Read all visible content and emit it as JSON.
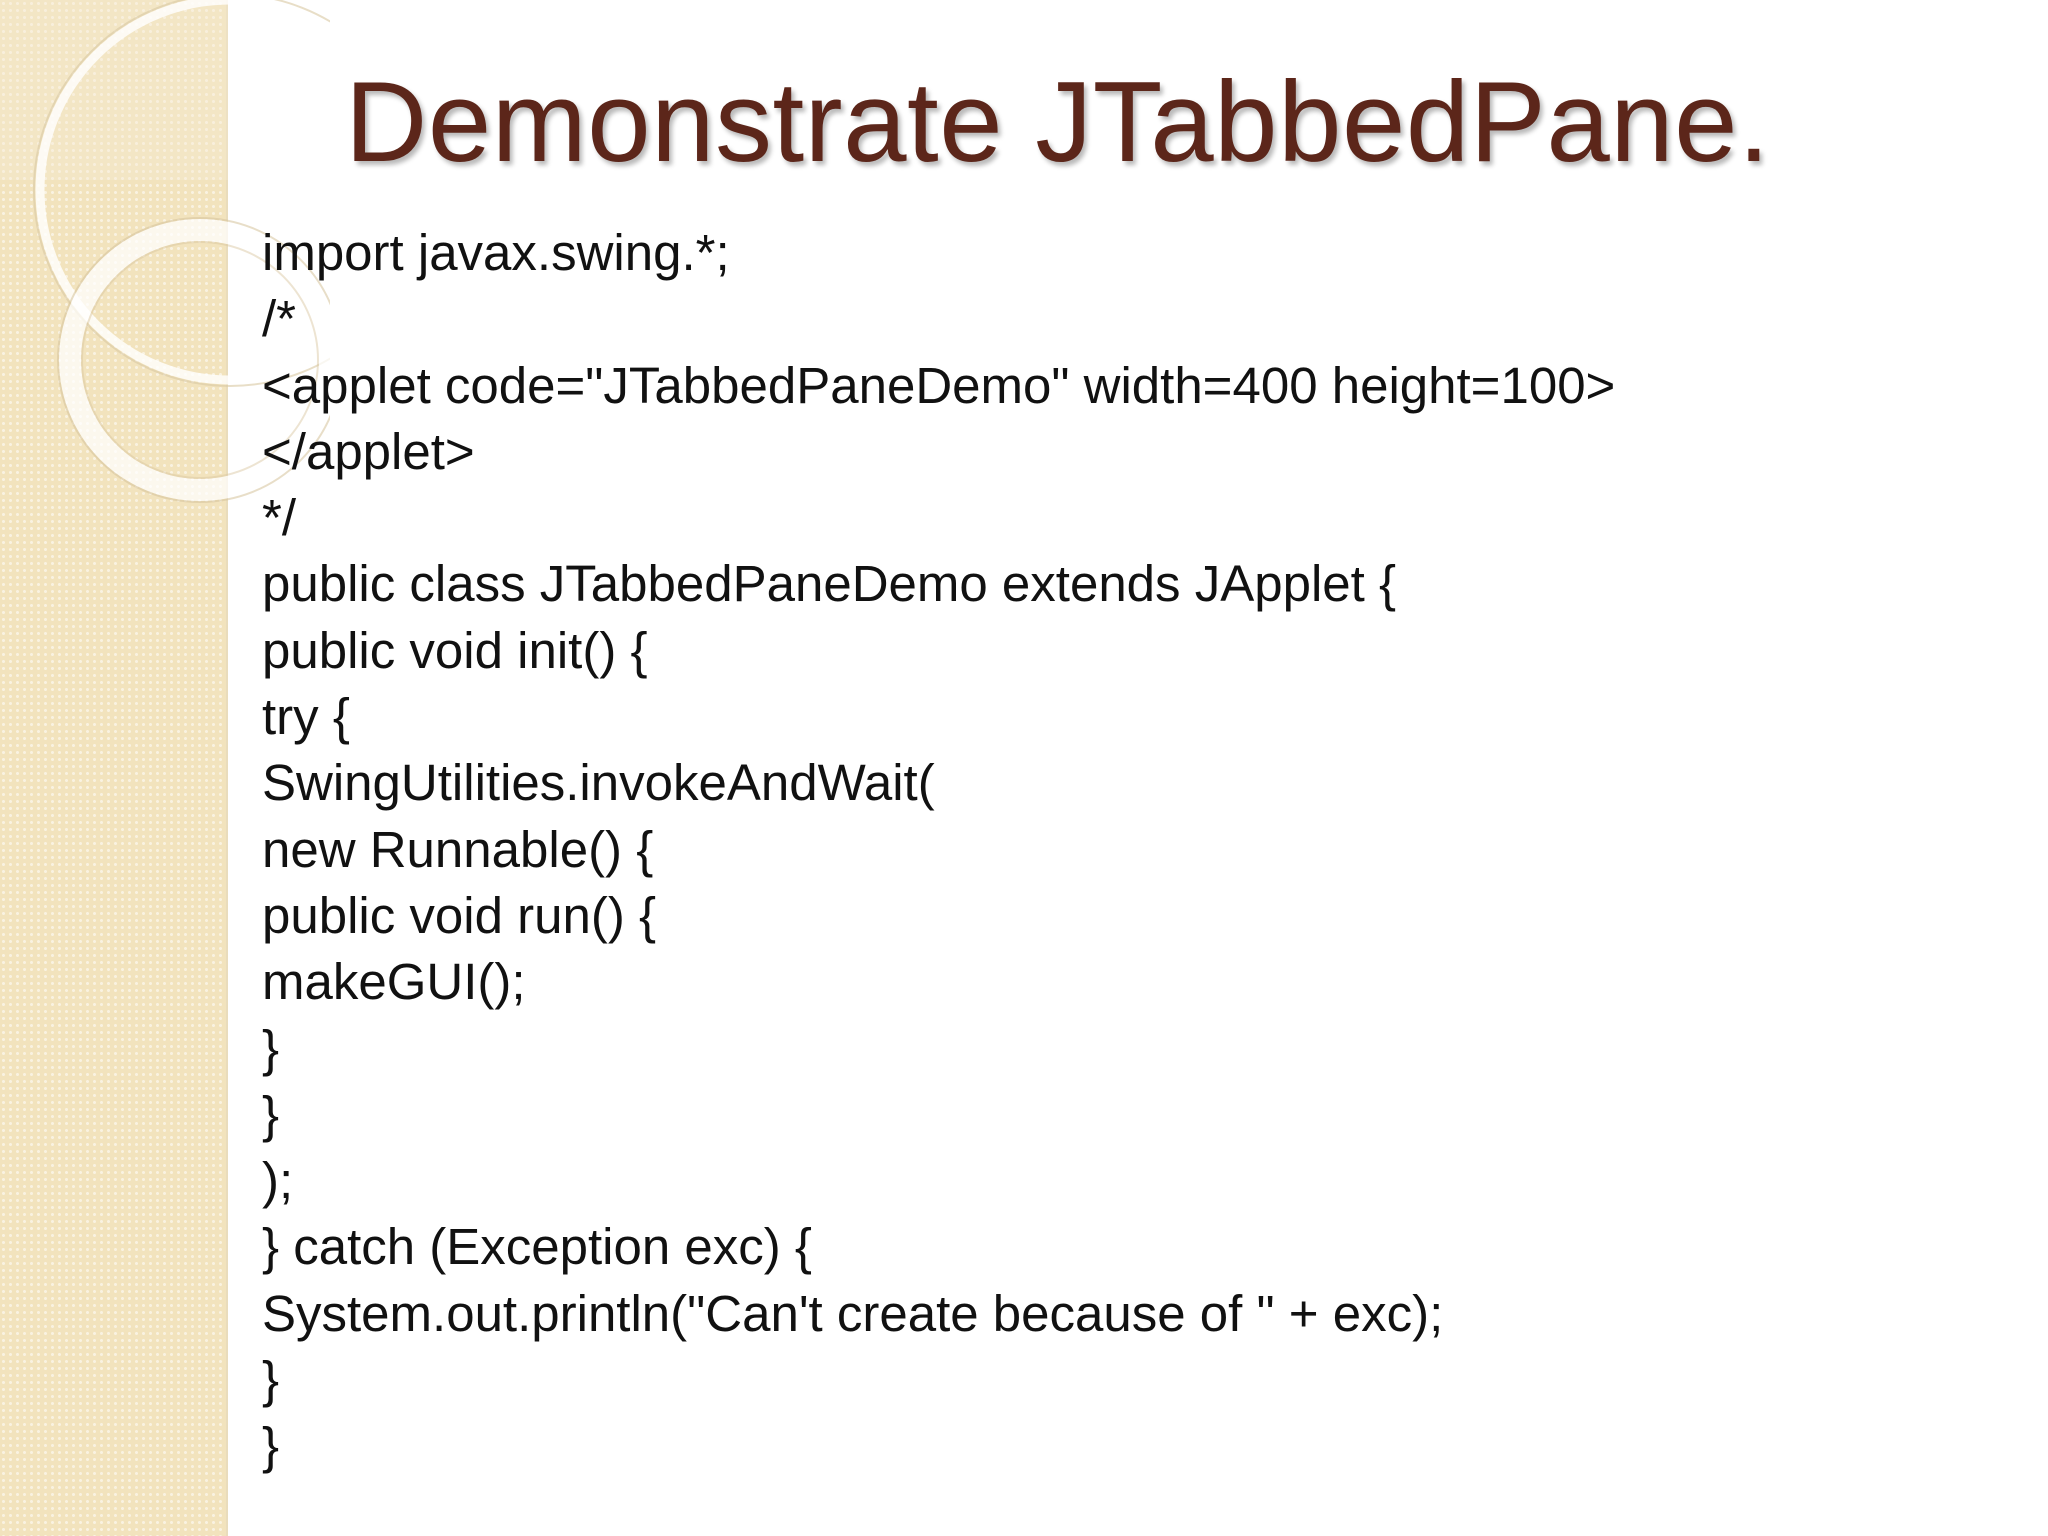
{
  "slide": {
    "title": "Demonstrate JTabbedPane.",
    "accent_color": "#5c261a",
    "sidebar_color": "#f2e3bd",
    "code_lines": [
      "import javax.swing.*;",
      "/*",
      "<applet code=\"JTabbedPaneDemo\" width=400 height=100>",
      "</applet>",
      "*/",
      "public class JTabbedPaneDemo extends JApplet {",
      "public void init() {",
      "try {",
      "SwingUtilities.invokeAndWait(",
      "new Runnable() {",
      "public void run() {",
      "makeGUI();",
      "}",
      "}",
      ");",
      "} catch (Exception exc) {",
      "System.out.println(\"Can't create because of \" + exc);",
      "}",
      "}"
    ]
  }
}
